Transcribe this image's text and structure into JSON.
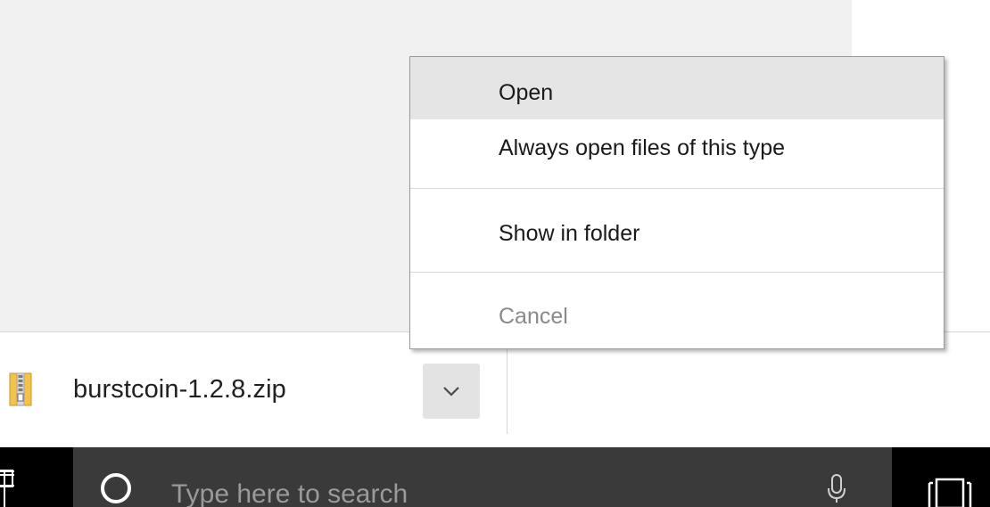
{
  "download": {
    "file_name": "burstcoin-1.2.8.zip",
    "file_icon": "zip-archive-icon",
    "dropdown_icon": "chevron-down-icon"
  },
  "context_menu": {
    "items": [
      {
        "label": "Open",
        "state": "hover"
      },
      {
        "label": "Always open files of this type",
        "state": "normal"
      },
      {
        "label": "Show in folder",
        "state": "normal"
      },
      {
        "label": "Cancel",
        "state": "disabled"
      }
    ]
  },
  "taskbar": {
    "start_icon": "windows-logo-icon",
    "search": {
      "placeholder": "Type here to search",
      "left_icon": "cortana-circle-icon",
      "right_icon": "microphone-icon"
    },
    "task_view_icon": "task-view-icon"
  },
  "colors": {
    "content_bg": "#f1f1f1",
    "menu_hover": "#e5e5e5",
    "disabled_text": "#8a8a8a",
    "taskbar_bg": "#000000",
    "search_bg": "#3a3a3a"
  }
}
